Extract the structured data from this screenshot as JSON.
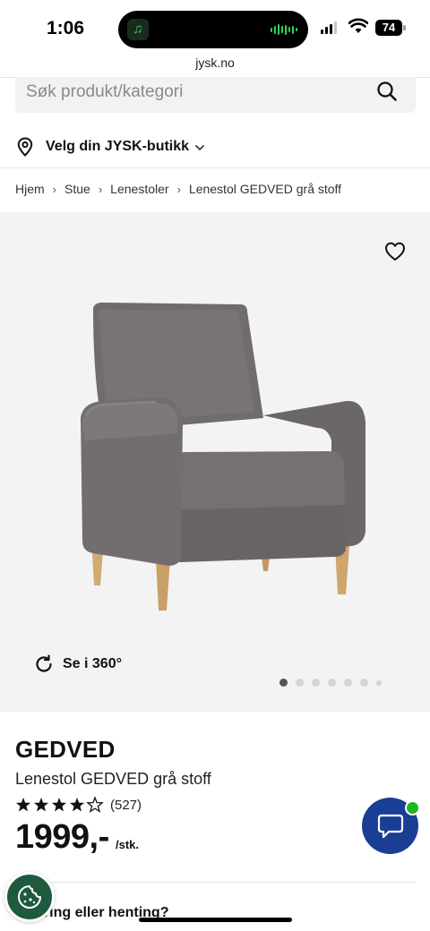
{
  "status_bar": {
    "time": "1:06",
    "battery": "74"
  },
  "browser": {
    "url": "jysk.no"
  },
  "search": {
    "placeholder": "Søk produkt/kategori",
    "icon": "search-icon"
  },
  "store_selector": {
    "label": "Velg din JYSK-butikk",
    "icon": "location-pin-icon"
  },
  "breadcrumb": {
    "items": [
      "Hjem",
      "Stue",
      "Lenestoler",
      "Lenestol GEDVED grå stoff"
    ]
  },
  "gallery": {
    "view360_label": "Se i 360°",
    "image_count": 7,
    "active_index": 0
  },
  "product": {
    "brand": "GEDVED",
    "name": "Lenestol GEDVED grå stoff",
    "rating": 4,
    "rating_max": 5,
    "review_count": "(527)",
    "price": "1999,-",
    "unit": "/stk."
  },
  "delivery": {
    "heading": "ering eller henting?"
  },
  "colors": {
    "accent_blue": "#1a3e94",
    "online_green": "#1fb51f",
    "cookie_green": "#1f5a3e"
  }
}
